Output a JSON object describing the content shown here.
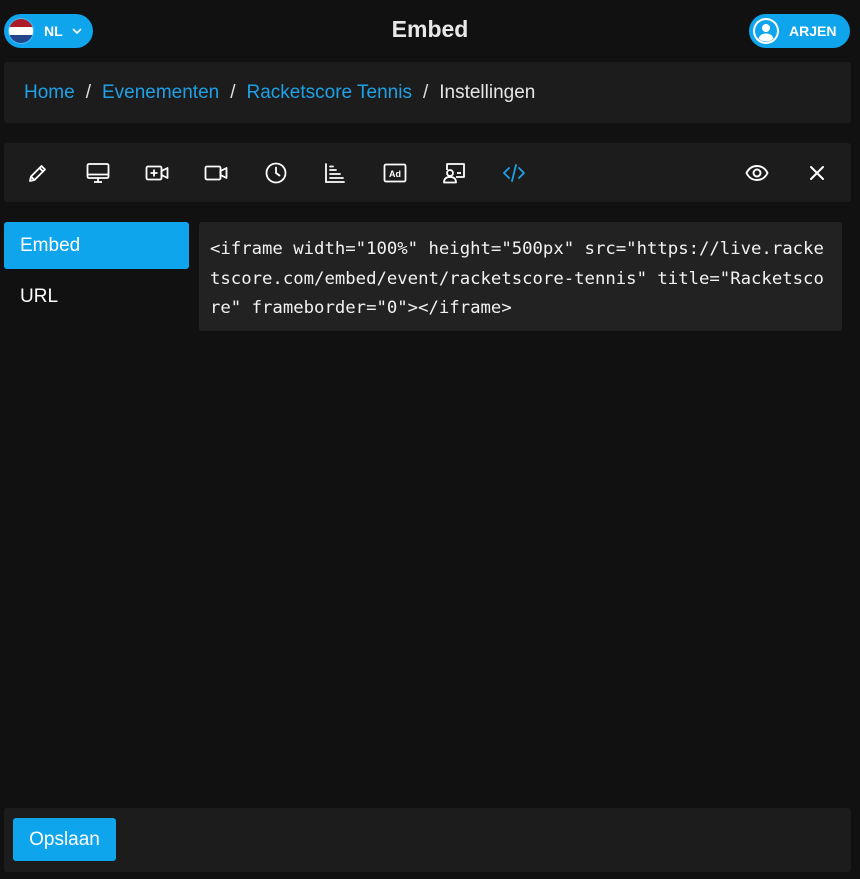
{
  "header": {
    "title": "Embed",
    "language": {
      "label": "NL",
      "flag_colors": [
        "#ae1c28",
        "#ffffff",
        "#21468b"
      ]
    },
    "user": {
      "label": "ARJEN"
    }
  },
  "breadcrumb": {
    "items": [
      "Home",
      "Evenementen",
      "Racketscore Tennis"
    ],
    "separator": "/",
    "current": "Instellingen"
  },
  "toolbar": {
    "icons": [
      "pencil-icon",
      "monitor-icon",
      "video-add-icon",
      "video-icon",
      "clock-icon",
      "chart-icon",
      "ad-icon",
      "presenter-icon",
      "code-icon",
      "eye-icon",
      "close-icon"
    ],
    "active": "code-icon"
  },
  "sidebar": {
    "items": [
      {
        "label": "Embed",
        "active": true
      },
      {
        "label": "URL",
        "active": false
      }
    ]
  },
  "embed": {
    "code": "<iframe width=\"100%\" height=\"500px\" src=\"https://live.racketscore.com/embed/event/racketscore-tennis\" title=\"Racketscore\" frameborder=\"0\"></iframe>"
  },
  "footer": {
    "save_label": "Opslaan"
  },
  "colors": {
    "accent": "#0ea5ec",
    "link": "#1ea1e6",
    "background": "#111111",
    "panel": "#1c1c1c"
  }
}
